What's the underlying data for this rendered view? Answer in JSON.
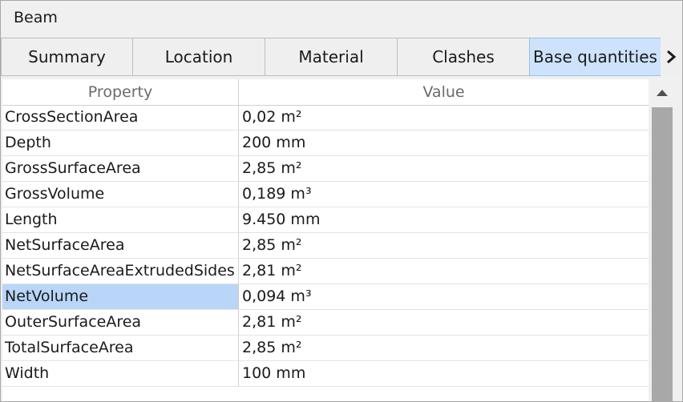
{
  "window": {
    "title": "Beam"
  },
  "tabs": [
    {
      "label": "Summary",
      "active": false
    },
    {
      "label": "Location",
      "active": false
    },
    {
      "label": "Material",
      "active": false
    },
    {
      "label": "Clashes",
      "active": false
    },
    {
      "label": "Base quantities",
      "active": true
    }
  ],
  "table": {
    "headers": {
      "property": "Property",
      "value": "Value"
    },
    "rows": [
      {
        "property": "CrossSectionArea",
        "value": "0,02 m²"
      },
      {
        "property": "Depth",
        "value": "200 mm"
      },
      {
        "property": "GrossSurfaceArea",
        "value": "2,85 m²"
      },
      {
        "property": "GrossVolume",
        "value": "0,189 m³"
      },
      {
        "property": "Length",
        "value": "9.450 mm"
      },
      {
        "property": "NetSurfaceArea",
        "value": "2,85 m²"
      },
      {
        "property": "NetSurfaceAreaExtrudedSides",
        "value": "2,81 m²"
      },
      {
        "property": "NetVolume",
        "value": "0,094 m³",
        "selected": true
      },
      {
        "property": "OuterSurfaceArea",
        "value": "2,81 m²"
      },
      {
        "property": "TotalSurfaceArea",
        "value": "2,85 m²"
      },
      {
        "property": "Width",
        "value": "100 mm"
      }
    ]
  },
  "icons": {
    "tab_scroll": "chevron-right-icon",
    "scroll_up": "triangle-up-icon"
  },
  "colors": {
    "active_tab": "#cde3fb",
    "selected_cell": "#b9d6f8",
    "scroll_thumb": "#a8a8a8"
  }
}
